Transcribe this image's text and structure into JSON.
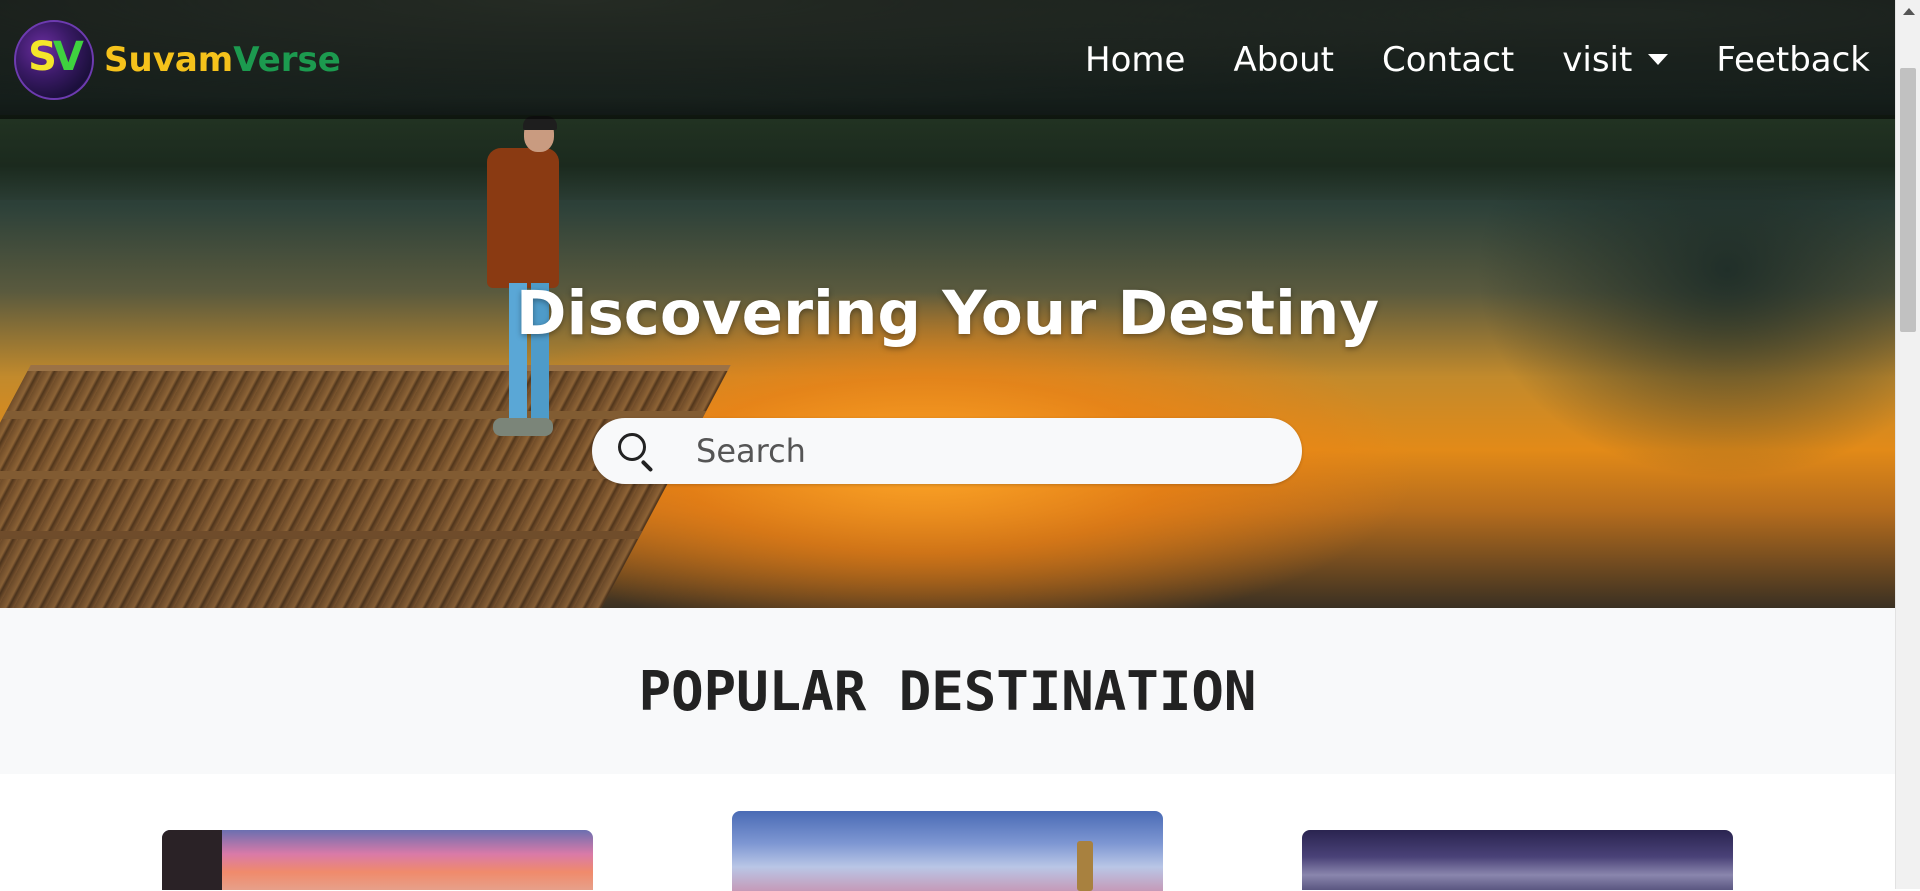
{
  "navbar": {
    "logo_letters_1": "S",
    "logo_letters_2": "V",
    "brand_part1": "Suvam",
    "brand_part2": "Verse",
    "links": [
      {
        "label": "Home"
      },
      {
        "label": "About"
      },
      {
        "label": "Contact"
      },
      {
        "label": "visit"
      },
      {
        "label": "Feetback"
      }
    ]
  },
  "hero": {
    "title": "Discovering Your Destiny",
    "search_placeholder": "Search"
  },
  "popular": {
    "title": "POPULAR DESTINATION"
  },
  "colors": {
    "brand_part1": "#f5c21b",
    "brand_part2": "#1c9a4f",
    "nav_background": "rgba(0,0,0,0.55)",
    "section_background": "#f8f9fa"
  },
  "icons": {
    "search": "search-icon",
    "dropdown": "caret-down-icon"
  }
}
